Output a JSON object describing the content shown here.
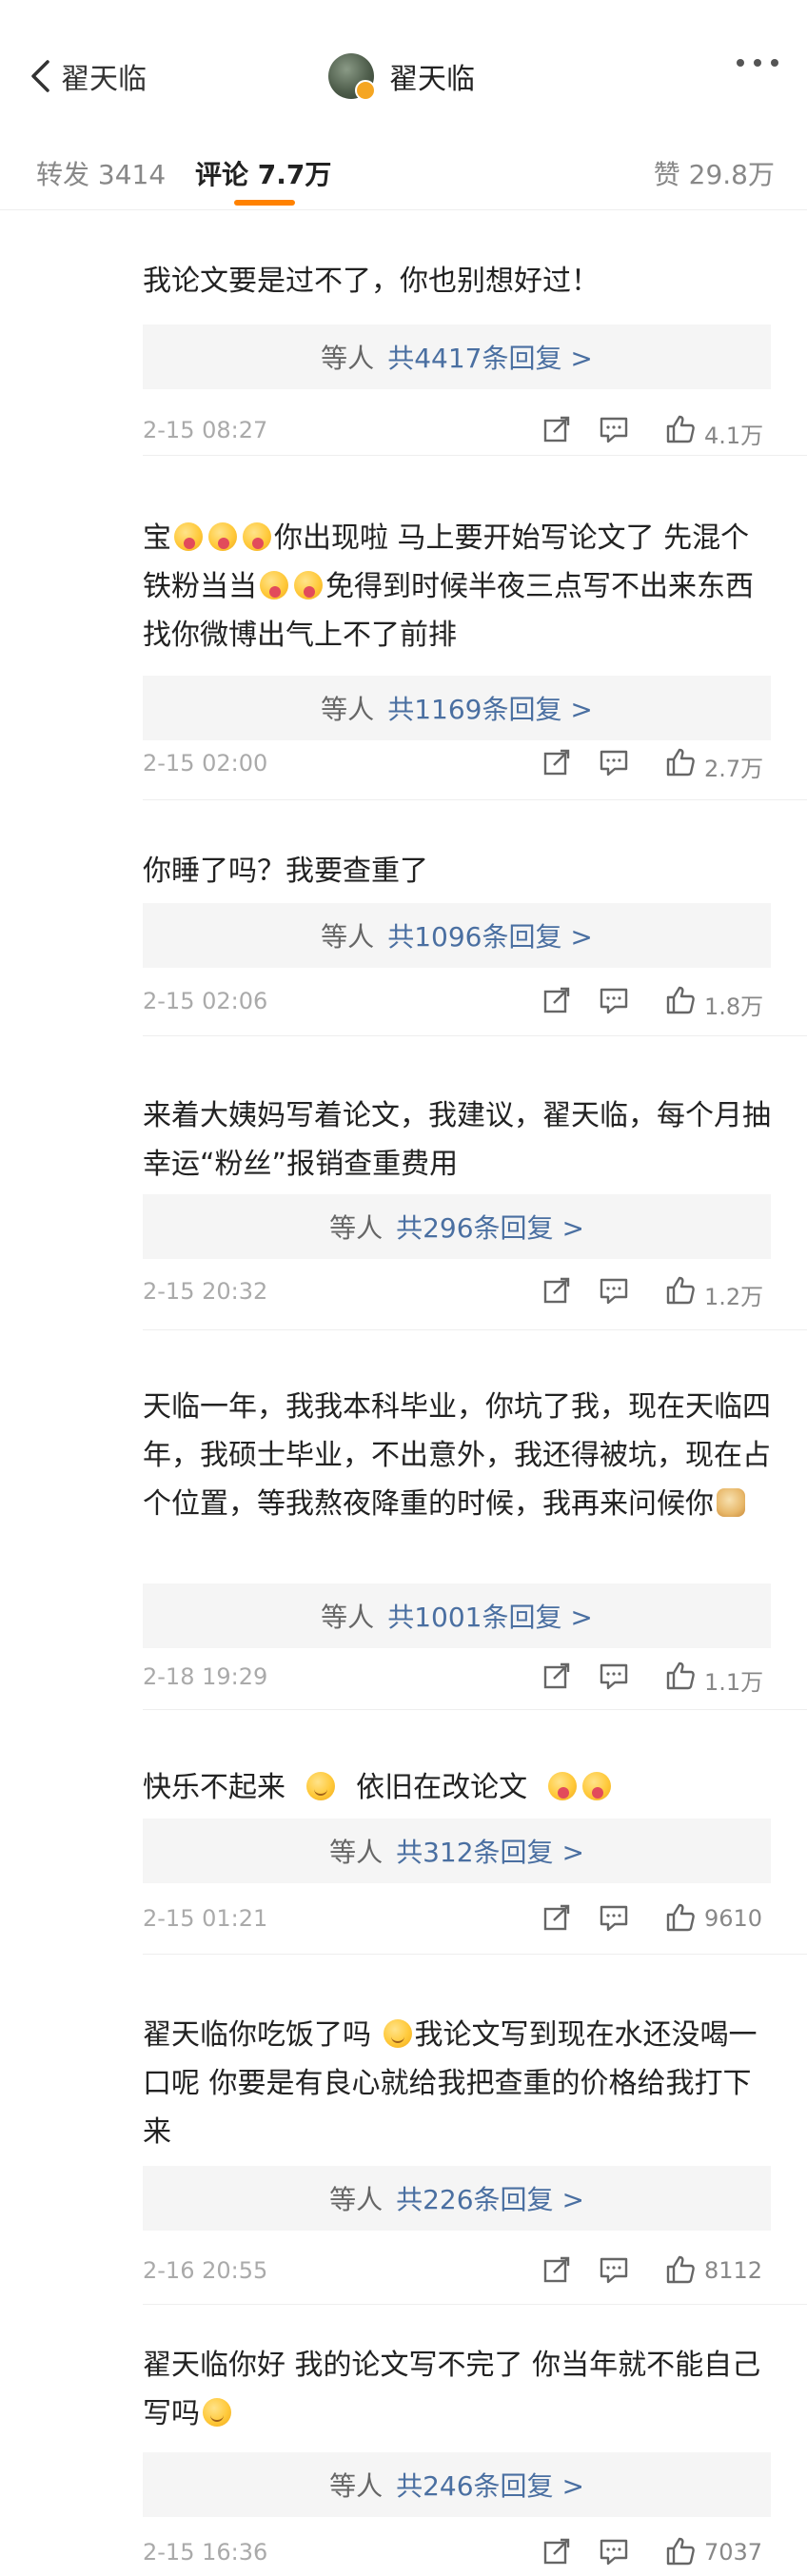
{
  "header": {
    "back_label": "翟天临",
    "title": "翟天临"
  },
  "tabs": {
    "repost_label": "转发",
    "repost_count": "3414",
    "comment_label": "评论",
    "comment_count": "7.7万",
    "like_label": "赞",
    "like_count": "29.8万"
  },
  "comments": [
    {
      "text": [
        "我论文要是过不了，你也别想好过！"
      ],
      "reply_prefix": "等人",
      "reply_count": "共4417条回复 >",
      "time": "2-15 08:27",
      "likes": "4.1万"
    },
    {
      "text_a": "宝",
      "text_b": "你出现啦 马上要开始写论文了 先混个铁粉当当",
      "text_c": "免得到时候半夜三点写不出来东西找你微博出气上不了前排",
      "reply_prefix": "等人",
      "reply_count": "共1169条回复 >",
      "time": "2-15 02:00",
      "likes": "2.7万"
    },
    {
      "text": [
        "你睡了吗？我要查重了"
      ],
      "reply_prefix": "等人",
      "reply_count": "共1096条回复 >",
      "time": "2-15 02:06",
      "likes": "1.8万"
    },
    {
      "text": [
        "来着大姨妈写着论文，我建议，翟天临，每个月抽幸运“粉丝”报销查重费用"
      ],
      "reply_prefix": "等人",
      "reply_count": "共296条回复 >",
      "time": "2-15 20:32",
      "likes": "1.2万"
    },
    {
      "text_a": "天临一年，我我本科毕业，你坑了我，现在天临四年，我硕士毕业，不出意外，我还得被坑，现在占个位置，等我熬夜降重的时候，我再来问候你",
      "reply_prefix": "等人",
      "reply_count": "共1001条回复 >",
      "time": "2-18 19:29",
      "likes": "1.1万"
    },
    {
      "text_a": "快乐不起来",
      "text_b": "依旧在改论文",
      "reply_prefix": "等人",
      "reply_count": "共312条回复 >",
      "time": "2-15 01:21",
      "likes": "9610"
    },
    {
      "text_a": "翟天临你吃饭了吗",
      "text_b": "我论文写到现在水还没喝一口呢 你要是有良心就给我把查重的价格给我打下来",
      "reply_prefix": "等人",
      "reply_count": "共226条回复 >",
      "time": "2-16 20:55",
      "likes": "8112"
    },
    {
      "text_a": "翟天临你好 我的论文写不完了 你当年就不能自己写吗",
      "reply_prefix": "等人",
      "reply_count": "共246条回复 >",
      "time": "2-15 16:36",
      "likes": "7037"
    }
  ],
  "icons": {
    "back": "chevron-left-icon",
    "more": "more-dots-icon",
    "share": "share-icon",
    "comment": "comment-icon",
    "like": "thumbs-up-icon",
    "emoji_tongue": "tongue-out-emoji",
    "emoji_smile": "smile-emoji",
    "emoji_doge": "doge-emoji"
  },
  "colors": {
    "accent": "#ff8200",
    "link": "#4a6fa1",
    "muted": "#aaaaaa"
  }
}
